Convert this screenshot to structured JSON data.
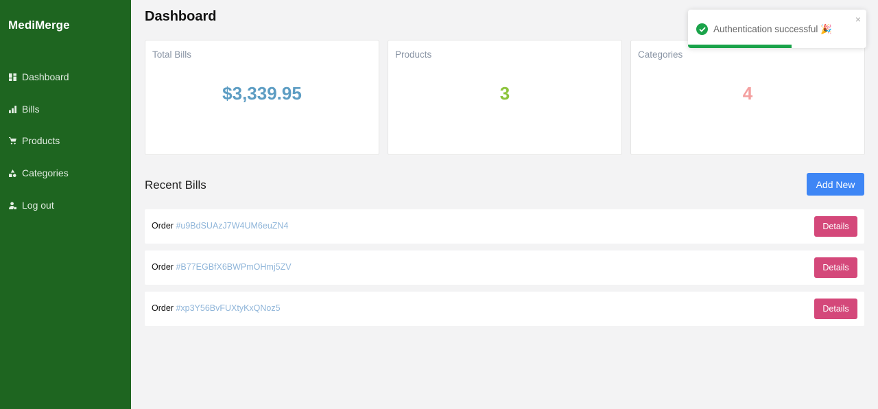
{
  "sidebar": {
    "brand": "MediMerge",
    "items": [
      {
        "label": "Dashboard",
        "icon": "dashboard-icon"
      },
      {
        "label": "Bills",
        "icon": "bar-chart-icon"
      },
      {
        "label": "Products",
        "icon": "cart-icon"
      },
      {
        "label": "Categories",
        "icon": "shapes-icon"
      },
      {
        "label": "Log out",
        "icon": "logout-user-icon"
      }
    ]
  },
  "header": {
    "title": "Dashboard"
  },
  "stats": [
    {
      "label": "Total Bills",
      "value": "$3,339.95",
      "color": "#5d9dc3"
    },
    {
      "label": "Products",
      "value": "3",
      "color": "#8cc43b"
    },
    {
      "label": "Categories",
      "value": "4",
      "color": "#f4a0a0"
    }
  ],
  "recent": {
    "title": "Recent Bills",
    "add_label": "Add New",
    "order_prefix": "Order",
    "details_label": "Details",
    "bills": [
      {
        "id": "#u9BdSUAzJ7W4UM6euZN4"
      },
      {
        "id": "#B77EGBfX6BWPmOHmj5ZV"
      },
      {
        "id": "#xp3Y56BvFUXtyKxQNoz5"
      }
    ]
  },
  "toast": {
    "message": "Authentication successful 🎉",
    "close": "×",
    "progress": 0.58
  },
  "colors": {
    "sidebar_bg": "#1e6520",
    "add_button": "#3e86f5",
    "details_button": "#d4487a",
    "toast_success": "#1aa34a"
  }
}
